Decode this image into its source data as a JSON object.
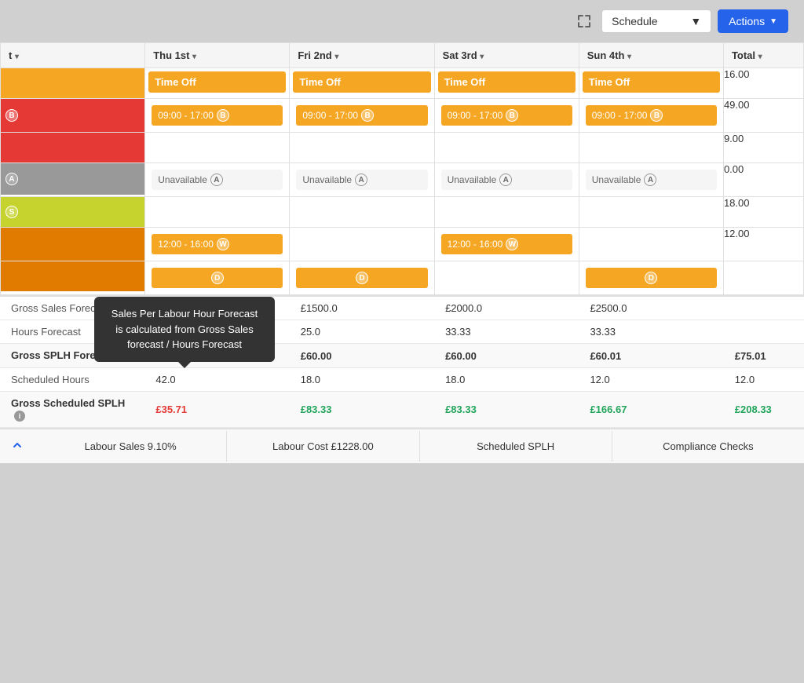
{
  "toolbar": {
    "schedule_label": "Schedule",
    "actions_label": "Actions"
  },
  "table": {
    "headers": [
      {
        "label": "t ▾",
        "id": "name"
      },
      {
        "label": "Thu 1st ▾",
        "id": "thu"
      },
      {
        "label": "Fri 2nd ▾",
        "id": "fri"
      },
      {
        "label": "Sat 3rd ▾",
        "id": "sat"
      },
      {
        "label": "Sun 4th ▾",
        "id": "sun"
      },
      {
        "label": "Total ▾",
        "id": "total"
      }
    ],
    "rows": [
      {
        "barColor": "bar-orange",
        "thu": {
          "type": "timeoff",
          "label": "Time Off"
        },
        "fri": {
          "type": "timeoff",
          "label": "Time Off"
        },
        "sat": {
          "type": "timeoff",
          "label": "Time Off"
        },
        "sun": {
          "type": "timeoff",
          "label": "Time Off"
        },
        "total": "16.00"
      },
      {
        "barColor": "bar-red",
        "thu": {
          "type": "shift",
          "label": "09:00 - 17:00",
          "badge": "B"
        },
        "fri": {
          "type": "shift",
          "label": "09:00 - 17:00",
          "badge": "B"
        },
        "sat": {
          "type": "shift",
          "label": "09:00 - 17:00",
          "badge": "B"
        },
        "sun": {
          "type": "shift",
          "label": "09:00 - 17:00",
          "badge": "B"
        },
        "total": "49.00"
      },
      {
        "barColor": "bar-red",
        "thu": {
          "type": "empty"
        },
        "fri": {
          "type": "empty"
        },
        "sat": {
          "type": "empty"
        },
        "sun": {
          "type": "empty"
        },
        "total": "9.00"
      },
      {
        "barColor": "bar-gray",
        "thu": {
          "type": "unavailable",
          "label": "Unavailable",
          "badge": "A"
        },
        "fri": {
          "type": "unavailable",
          "label": "Unavailable",
          "badge": "A"
        },
        "sat": {
          "type": "unavailable",
          "label": "Unavailable",
          "badge": "A"
        },
        "sun": {
          "type": "unavailable",
          "label": "Unavailable",
          "badge": "A"
        },
        "total": "0.00"
      },
      {
        "barColor": "bar-yellow-green",
        "thu": {
          "type": "empty"
        },
        "fri": {
          "type": "empty"
        },
        "sat": {
          "type": "empty"
        },
        "sun": {
          "type": "empty"
        },
        "total": "18.00"
      },
      {
        "barColor": "bar-dark-orange",
        "thu": {
          "type": "shift",
          "label": "12:00 - 16:00",
          "badge": "W"
        },
        "fri": {
          "type": "empty"
        },
        "sat": {
          "type": "shift",
          "label": "12:00 - 16:00",
          "badge": "W"
        },
        "sun": {
          "type": "empty"
        },
        "total": "12.00"
      },
      {
        "barColor": "bar-dark-orange",
        "thu": {
          "type": "shift-partial",
          "badge": "D"
        },
        "fri": {
          "type": "shift-partial",
          "badge": "D"
        },
        "sat": {
          "type": "empty"
        },
        "sun": {
          "type": "shift-partial",
          "badge": "D"
        },
        "total": ""
      }
    ]
  },
  "stats": {
    "tooltip": {
      "text": "Sales Per Labour Hour Forecast is calculated from Gross Sales forecast / Hours Forecast"
    },
    "rows": [
      {
        "label": "Gross Sales Forec...",
        "bold": false,
        "cols": [
          "",
          "£1500.0",
          "£1500.0",
          "£2000.0",
          "£2500.0"
        ],
        "colorClass": [
          "",
          "",
          "",
          "",
          ""
        ]
      },
      {
        "label": "Hours Forecast",
        "bold": false,
        "cols": [
          "",
          "25.0",
          "25.0",
          "33.33",
          "33.33"
        ],
        "colorClass": [
          "",
          "",
          "",
          "",
          ""
        ]
      },
      {
        "label": "Gross SPLH Forecast",
        "bold": true,
        "hasInfo": true,
        "cols": [
          "£60.00",
          "£60.00",
          "£60.00",
          "£60.01",
          "£75.01"
        ],
        "colorClass": [
          "bold",
          "bold",
          "bold",
          "bold",
          "bold"
        ]
      },
      {
        "label": "Scheduled Hours",
        "bold": false,
        "cols": [
          "42.0",
          "18.0",
          "18.0",
          "12.0",
          "12.0"
        ],
        "colorClass": [
          "",
          "",
          "",
          "",
          ""
        ]
      },
      {
        "label": "Gross Scheduled SPLH",
        "bold": true,
        "hasInfo": true,
        "cols": [
          "£35.71",
          "£83.33",
          "£83.33",
          "£166.67",
          "£208.33"
        ],
        "colorClass": [
          "red",
          "green",
          "green",
          "green",
          "green"
        ]
      }
    ]
  },
  "bottom_bar": {
    "items": [
      "Labour Sales 9.10%",
      "Labour Cost £1228.00",
      "Scheduled SPLH",
      "Compliance Checks"
    ]
  }
}
